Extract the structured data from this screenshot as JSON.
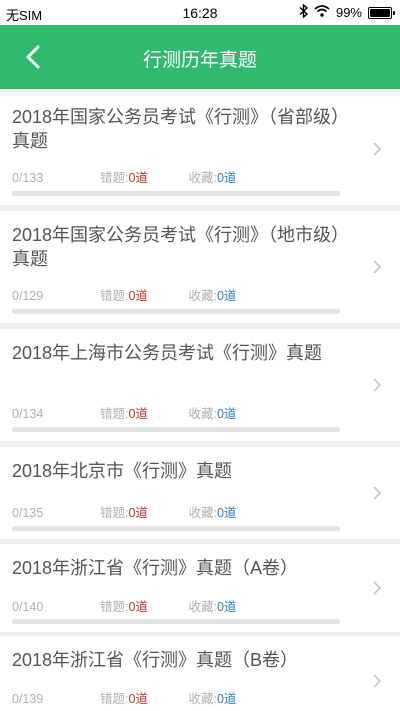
{
  "status_bar": {
    "carrier": "无SIM",
    "time": "16:28",
    "battery": "99%",
    "battery_level": 0.99
  },
  "header": {
    "title": "行测历年真题"
  },
  "labels": {
    "wrong": "错题:",
    "favorite": "收藏:"
  },
  "items": [
    {
      "title": "2018年国家公务员考试《行测》（省部级）真题",
      "progress": "0/133",
      "done": 0,
      "total": 133,
      "wrong": "0道",
      "favorite": "0道"
    },
    {
      "title": "2018年国家公务员考试《行测》（地市级）真题",
      "progress": "0/129",
      "done": 0,
      "total": 129,
      "wrong": "0道",
      "favorite": "0道"
    },
    {
      "title": "2018年上海市公务员考试《行测》真题",
      "progress": "0/134",
      "done": 0,
      "total": 134,
      "wrong": "0道",
      "favorite": "0道"
    },
    {
      "title": "2018年北京市《行测》真题",
      "progress": "0/135",
      "done": 0,
      "total": 135,
      "wrong": "0道",
      "favorite": "0道"
    },
    {
      "title": "2018年浙江省《行测》真题（A卷）",
      "progress": "0/140",
      "done": 0,
      "total": 140,
      "wrong": "0道",
      "favorite": "0道"
    },
    {
      "title": "2018年浙江省《行测》真题（B卷）",
      "progress": "0/139",
      "done": 0,
      "total": 139,
      "wrong": "0道",
      "favorite": "0道"
    }
  ],
  "colors": {
    "accent": "#2fba6f",
    "wrong_value": "#c0392b",
    "favorite_value": "#2f80d1"
  }
}
